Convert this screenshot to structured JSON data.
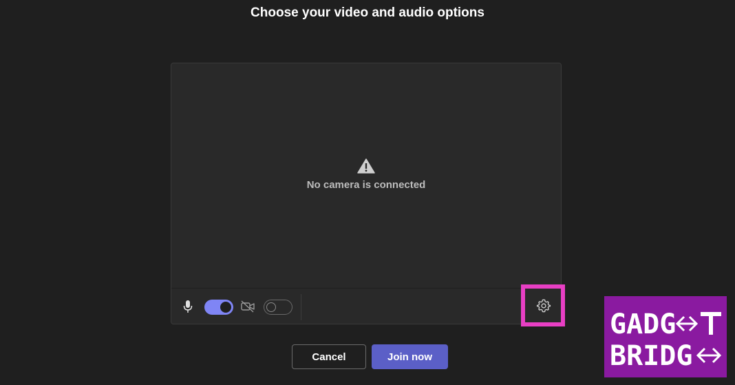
{
  "header": {
    "title": "Choose your video and audio options"
  },
  "preview": {
    "status_icon": "warning-icon",
    "status_text": "No camera is connected"
  },
  "controls": {
    "mic_icon": "microphone-icon",
    "mic_toggle_on": true,
    "camera_icon": "camera-off-icon",
    "camera_toggle_on": false,
    "settings_icon": "gear-icon"
  },
  "actions": {
    "cancel_label": "Cancel",
    "join_label": "Join now"
  },
  "watermark": {
    "line1": "GADG",
    "line2": "BRIDG"
  },
  "colors": {
    "accent": "#7f85f5",
    "join_button": "#5b5fc7",
    "highlight": "#e83fc4",
    "watermark_bg": "#8a1aa0",
    "background": "#1f1f1f"
  }
}
